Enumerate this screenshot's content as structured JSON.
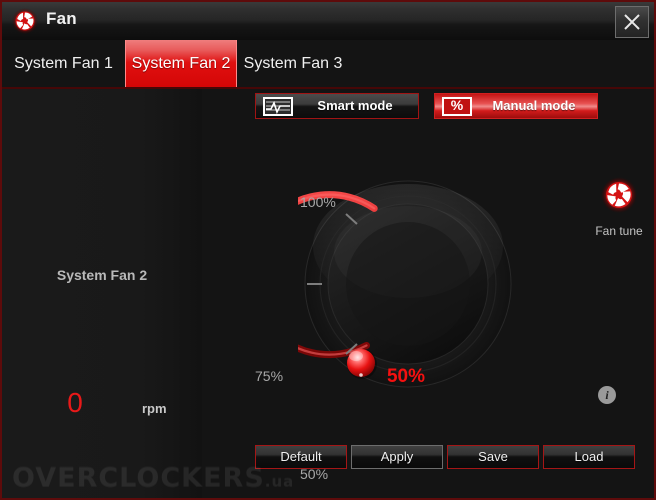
{
  "window": {
    "title": "Fan",
    "app_icon": "fan-logo-icon",
    "close_icon": "close-icon",
    "accent_color": "#e01010",
    "border_color": "#5e0b0b",
    "background_color": "#141414"
  },
  "tabs": [
    {
      "label": "System Fan 1",
      "active": false
    },
    {
      "label": "System Fan 2",
      "active": true
    },
    {
      "label": "System Fan 3",
      "active": false
    }
  ],
  "sidebar": {
    "fan_name": "System Fan 2",
    "rpm_value": "0",
    "rpm_unit": "rpm",
    "rpm_color": "#e81919"
  },
  "modes": {
    "smart": {
      "label": "Smart mode",
      "icon": "waveform-chart-icon",
      "active": false
    },
    "manual": {
      "label": "Manual mode",
      "icon": "percent-icon",
      "active": true
    }
  },
  "dial": {
    "center_value": "50%",
    "center_value_color": "#f51010",
    "ticks": [
      {
        "label": "100%"
      },
      {
        "label": "75%"
      },
      {
        "label": "50%"
      }
    ]
  },
  "fan_tune": {
    "label": "Fan tune",
    "icon": "fan-logo-icon"
  },
  "info": {
    "icon": "info-icon",
    "glyph": "i"
  },
  "actions": [
    {
      "label": "Default",
      "style": "accent"
    },
    {
      "label": "Apply",
      "style": "neutral"
    },
    {
      "label": "Save",
      "style": "accent"
    },
    {
      "label": "Load",
      "style": "accent"
    }
  ],
  "watermark": {
    "text": "OVERCLOCKERS",
    "suffix": ".ua"
  }
}
